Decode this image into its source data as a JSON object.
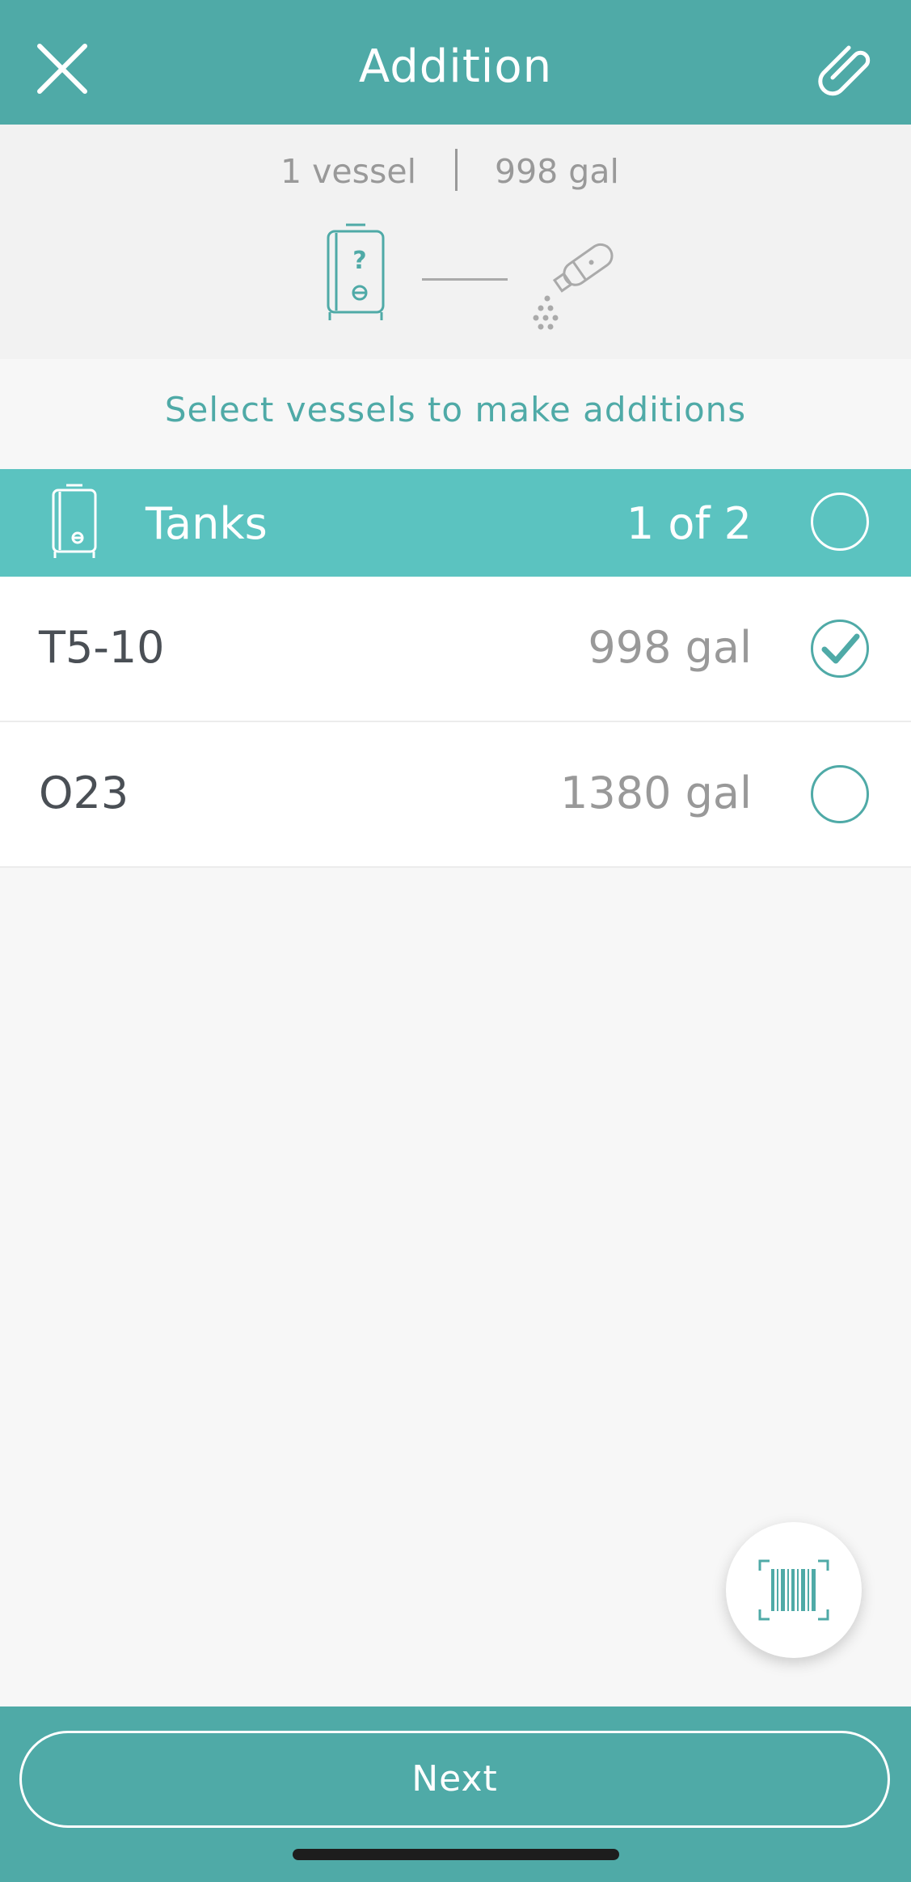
{
  "header": {
    "title": "Addition",
    "close_icon": "close-icon",
    "attach_icon": "paperclip-icon"
  },
  "summary": {
    "vessel_count": "1 vessel",
    "total_volume": "998 gal",
    "source_icon": "tank-unknown-icon",
    "target_icon": "additive-shaker-icon"
  },
  "instruction": "Select vessels to make additions",
  "group": {
    "label": "Tanks",
    "count": "1 of 2",
    "icon": "tank-icon",
    "selected": false
  },
  "vessels": [
    {
      "name": "T5-10",
      "volume": "998 gal",
      "selected": true
    },
    {
      "name": "O23",
      "volume": "1380 gal",
      "selected": false
    }
  ],
  "scan_icon": "barcode-scan-icon",
  "footer": {
    "next_label": "Next"
  },
  "colors": {
    "primary": "#4faaa7",
    "group_header": "#5bc3c0",
    "text_dark": "#4a4f55",
    "text_muted": "#999999"
  }
}
